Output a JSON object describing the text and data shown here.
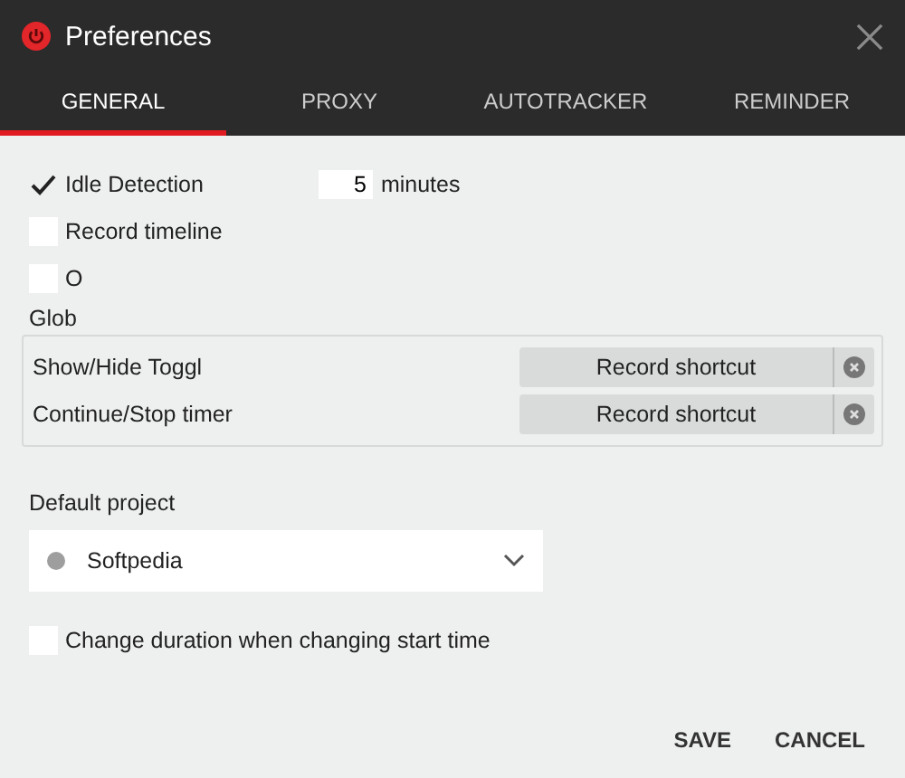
{
  "window": {
    "title": "Preferences"
  },
  "tabs": [
    {
      "label": "GENERAL",
      "selected": true
    },
    {
      "label": "PROXY",
      "selected": false
    },
    {
      "label": "AUTOTRACKER",
      "selected": false
    },
    {
      "label": "REMINDER",
      "selected": false
    }
  ],
  "idle_detection": {
    "label": "Idle Detection",
    "checked": true,
    "minutes_value": "5",
    "minutes_label": "minutes"
  },
  "record_timeline": {
    "label": "Record timeline",
    "checked": false
  },
  "option_3": {
    "label": "O",
    "checked": false
  },
  "shortcuts": {
    "heading": "Glob",
    "rows": [
      {
        "label": "Show/Hide Toggl",
        "button": "Record shortcut"
      },
      {
        "label": "Continue/Stop timer",
        "button": "Record shortcut"
      }
    ]
  },
  "default_project": {
    "label": "Default project",
    "value": "Softpedia",
    "color": "#9e9e9e"
  },
  "change_duration": {
    "label": "Change duration when changing start time",
    "checked": false
  },
  "buttons": [
    "SAVE",
    "CANCEL"
  ]
}
